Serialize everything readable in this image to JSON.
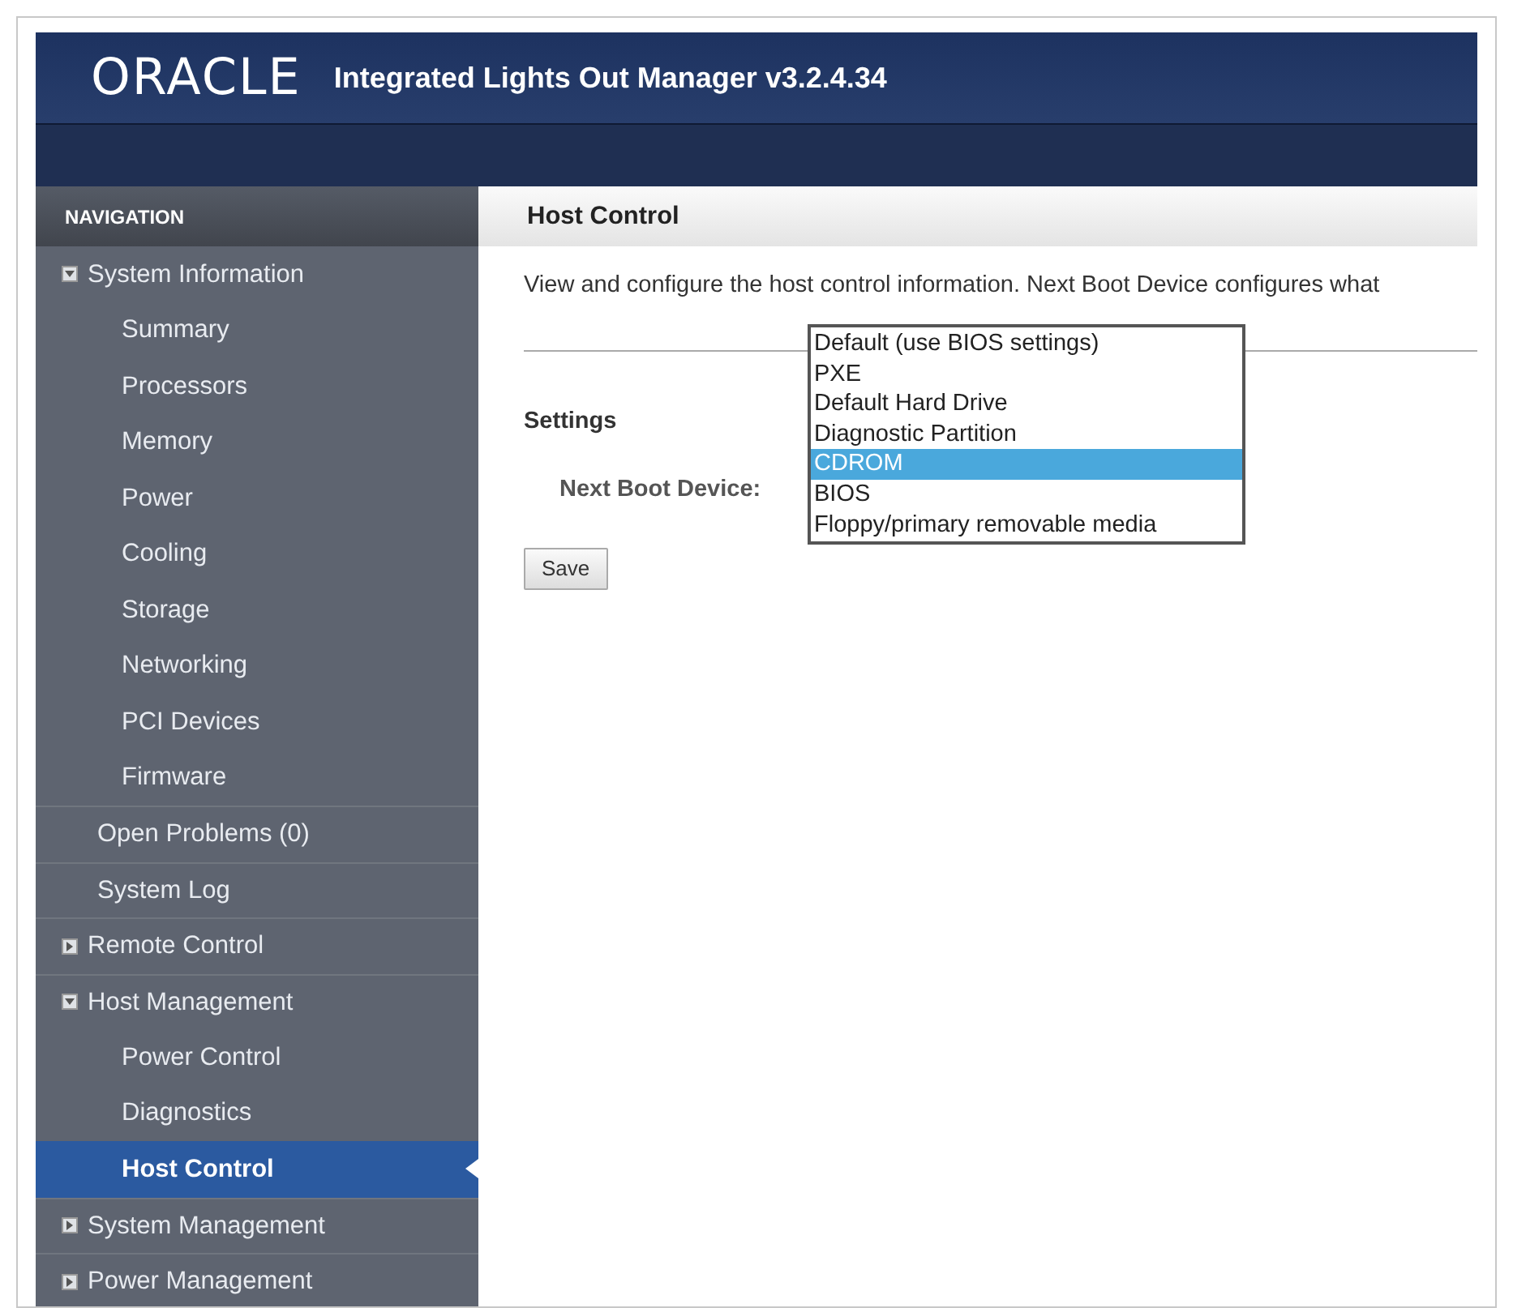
{
  "header": {
    "logo": "ORACLE",
    "title": "Integrated Lights Out Manager v3.2.4.34"
  },
  "navigation": {
    "heading": "NAVIGATION",
    "items": [
      {
        "kind": "group",
        "label": "System Information",
        "expanded": true,
        "selected": false,
        "children": [
          {
            "label": "Summary",
            "selected": false
          },
          {
            "label": "Processors",
            "selected": false
          },
          {
            "label": "Memory",
            "selected": false
          },
          {
            "label": "Power",
            "selected": false
          },
          {
            "label": "Cooling",
            "selected": false
          },
          {
            "label": "Storage",
            "selected": false
          },
          {
            "label": "Networking",
            "selected": false
          },
          {
            "label": "PCI Devices",
            "selected": false
          },
          {
            "label": "Firmware",
            "selected": false
          }
        ]
      },
      {
        "kind": "link",
        "label": "Open Problems (0)",
        "selected": false
      },
      {
        "kind": "link",
        "label": "System Log",
        "selected": false
      },
      {
        "kind": "group",
        "label": "Remote Control",
        "expanded": false,
        "selected": false
      },
      {
        "kind": "group",
        "label": "Host Management",
        "expanded": true,
        "selected": false,
        "children": [
          {
            "label": "Power Control",
            "selected": false
          },
          {
            "label": "Diagnostics",
            "selected": false
          },
          {
            "label": "Host Control",
            "selected": true
          }
        ]
      },
      {
        "kind": "group",
        "label": "System Management",
        "expanded": false,
        "selected": false
      },
      {
        "kind": "group",
        "label": "Power Management",
        "expanded": false,
        "selected": false
      }
    ]
  },
  "page": {
    "title": "Host Control",
    "description": "View and configure the host control information. Next Boot Device configures what",
    "section": "Settings",
    "field_label": "Next Boot Device:",
    "options": [
      {
        "label": "Default (use BIOS settings)",
        "selected": false
      },
      {
        "label": "PXE",
        "selected": false
      },
      {
        "label": "Default Hard Drive",
        "selected": false
      },
      {
        "label": "Diagnostic Partition",
        "selected": false
      },
      {
        "label": "CDROM",
        "selected": true
      },
      {
        "label": "BIOS",
        "selected": false
      },
      {
        "label": "Floppy/primary removable media",
        "selected": false
      }
    ],
    "save_button": "Save"
  }
}
